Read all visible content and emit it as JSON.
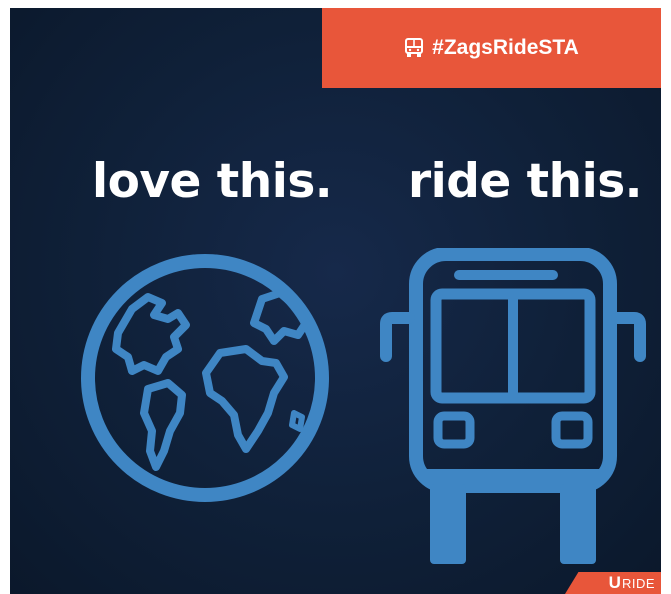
{
  "banner": {
    "hashtag": "#ZagsRideSTA",
    "icon": "bus-icon",
    "background_color": "#e8563a"
  },
  "headlines": {
    "left": "love this.",
    "right": "ride this."
  },
  "icons": {
    "left": "globe-icon",
    "right": "bus-front-icon",
    "color": "#3f86c4"
  },
  "logo": {
    "letter": "U",
    "word": "RIDE",
    "color": "#e8563a"
  },
  "background_color": "#0f2038"
}
